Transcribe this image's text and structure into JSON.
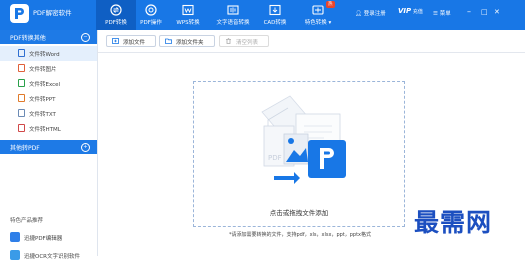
{
  "app": {
    "title": "PDF解密软件"
  },
  "nav": {
    "tabs": [
      {
        "label": "PDF转换",
        "icon": "convert-icon"
      },
      {
        "label": "PDF操作",
        "icon": "pdf-operate-icon"
      },
      {
        "label": "WPS转换",
        "icon": "wps-icon"
      },
      {
        "label": "文字语音转换",
        "icon": "text-speech-icon"
      },
      {
        "label": "CAD转换",
        "icon": "cad-icon"
      },
      {
        "label": "特色转换",
        "icon": "feature-icon",
        "badge": "热"
      }
    ]
  },
  "header_right": {
    "login": "登录注册",
    "vip": "VIP",
    "vip_sub": "充值",
    "menu": "菜单"
  },
  "window_controls": {
    "minimize": "–",
    "maximize": "□",
    "close": "✕"
  },
  "sidebar": {
    "group1": {
      "title": "PDF转换其他",
      "toggle": "⊖"
    },
    "items": [
      {
        "label": "文件转Word",
        "color": "#2f6fd1"
      },
      {
        "label": "文件转图片",
        "color": "#e0603a"
      },
      {
        "label": "文件转Excel",
        "color": "#2aa04a"
      },
      {
        "label": "文件转PPT",
        "color": "#e07a2a"
      },
      {
        "label": "文件转TXT",
        "color": "#6c8bb5"
      },
      {
        "label": "文件转HTML",
        "color": "#d04848"
      }
    ],
    "group2": {
      "title": "其他转PDF",
      "toggle": "⊕"
    },
    "recommend": {
      "title": "特色产品推荐",
      "items": [
        {
          "label": "迅捷PDF编辑器"
        },
        {
          "label": "迅捷OCR文字识别软件"
        }
      ]
    }
  },
  "toolbar": {
    "add_file": "添加文件",
    "add_folder": "添加文件夹",
    "clear_list": "清空列表"
  },
  "dropzone": {
    "label": "点击或拖拽文件添加"
  },
  "hint": "*请添加需要转换的文件，支持pdf，xls，xlsx，ppt，pptx格式",
  "watermark": "最需网",
  "colors": {
    "brand": "#1877e6",
    "active_tab": "#0f5fc4",
    "hot_badge": "#e8452c"
  }
}
